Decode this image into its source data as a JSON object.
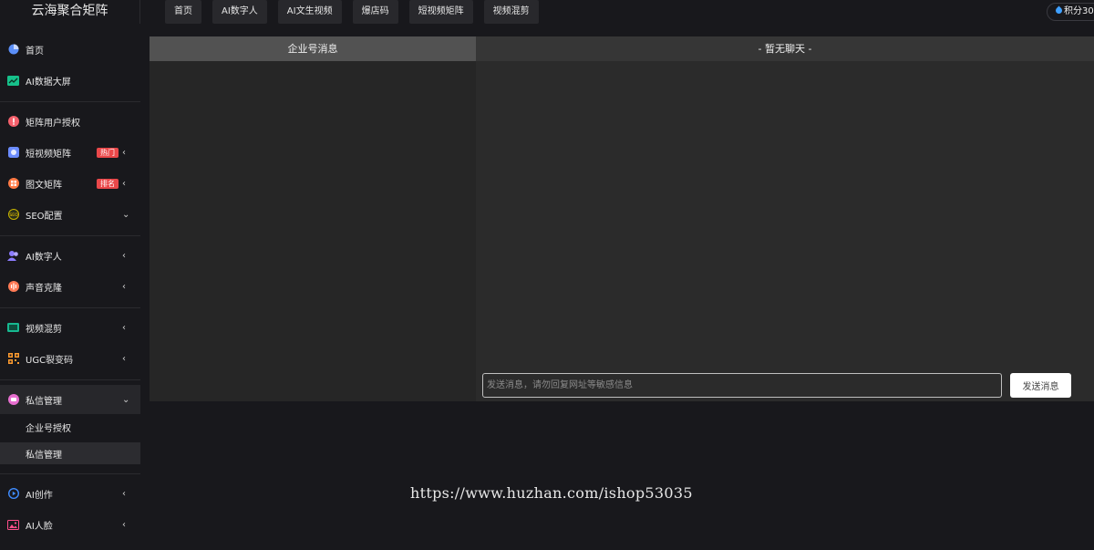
{
  "app": {
    "title": "云海聚合矩阵"
  },
  "topnav": [
    {
      "label": "首页"
    },
    {
      "label": "AI数字人"
    },
    {
      "label": "AI文生视频"
    },
    {
      "label": "爆店码"
    },
    {
      "label": "短视频矩阵"
    },
    {
      "label": "视频混剪"
    }
  ],
  "points": {
    "label": "积分30"
  },
  "sidebar": {
    "items": [
      {
        "label": "首页",
        "icon": "pie-chart-icon"
      },
      {
        "label": "AI数据大屏",
        "icon": "trend-chart-icon"
      },
      {
        "label": "矩阵用户授权",
        "icon": "user-auth-icon"
      },
      {
        "label": "短视频矩阵",
        "icon": "video-camera-icon",
        "badge": "热门"
      },
      {
        "label": "图文矩阵",
        "icon": "grid-icon",
        "badge": "排名"
      },
      {
        "label": "SEO配置",
        "icon": "seo-icon"
      },
      {
        "label": "AI数字人",
        "icon": "users-icon"
      },
      {
        "label": "声音克隆",
        "icon": "voice-icon"
      },
      {
        "label": "视频混剪",
        "icon": "film-icon"
      },
      {
        "label": "UGC裂变码",
        "icon": "qrcode-icon"
      },
      {
        "label": "私信管理",
        "icon": "message-icon"
      },
      {
        "label": "AI创作",
        "icon": "play-circle-icon"
      },
      {
        "label": "AI人脸",
        "icon": "face-image-icon"
      }
    ],
    "sub_items": [
      {
        "label": "企业号授权"
      },
      {
        "label": "私信管理"
      }
    ]
  },
  "chat": {
    "left_title": "企业号消息",
    "right_title": "- 暂无聊天 -",
    "input_placeholder": "发送消息，请勿回复网址等敏感信息",
    "send_label": "发送消息"
  },
  "watermark": "https://www.huzhan.com/ishop53035",
  "colors": {
    "badge": "#e9484a",
    "accent": "#3fa0ff"
  }
}
